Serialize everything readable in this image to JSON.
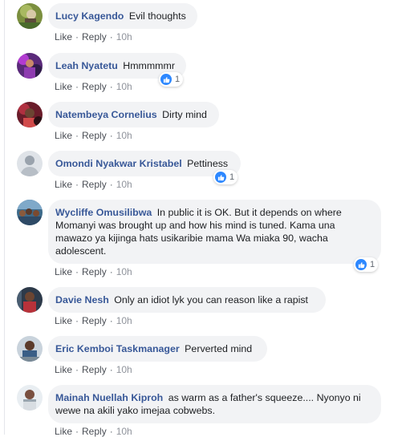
{
  "action_labels": {
    "like": "Like",
    "reply": "Reply",
    "separator": "·"
  },
  "comments": [
    {
      "author": "Lucy Kagendo",
      "text": "Evil thoughts",
      "time": "10h",
      "reaction_count": ""
    },
    {
      "author": "Leah Nyatetu",
      "text": "Hmmmmmr",
      "time": "10h",
      "reaction_count": "1"
    },
    {
      "author": "Natembeya Cornelius",
      "text": "Dirty mind",
      "time": "10h",
      "reaction_count": ""
    },
    {
      "author": "Omondi Nyakwar Kristabel",
      "text": "Pettiness",
      "time": "10h",
      "reaction_count": "1"
    },
    {
      "author": "Wycliffe Omusilibwa",
      "text": "In public it is OK. But it depends on where Momanyi was brought up and how his mind is tuned. Kama una mawazo ya kijinga hats usikaribie mama Wa miaka 90, wacha adolescent.",
      "time": "10h",
      "reaction_count": "1"
    },
    {
      "author": "Davie Nesh",
      "text": "Only an idiot lyk you can reason like a rapist",
      "time": "10h",
      "reaction_count": ""
    },
    {
      "author": "Eric Kemboi Taskmanager",
      "text": "Perverted mind",
      "time": "10h",
      "reaction_count": ""
    },
    {
      "author": "Mainah Nuellah Kiproh",
      "text": "as warm as a father's squeeze.... Nyonyo ni wewe na akili yako imejaa cobwebs.",
      "time": "10h",
      "reaction_count": ""
    }
  ],
  "colors": {
    "author": "#385898",
    "bubble": "#f2f3f5",
    "like_badge": "#2d88ff"
  }
}
